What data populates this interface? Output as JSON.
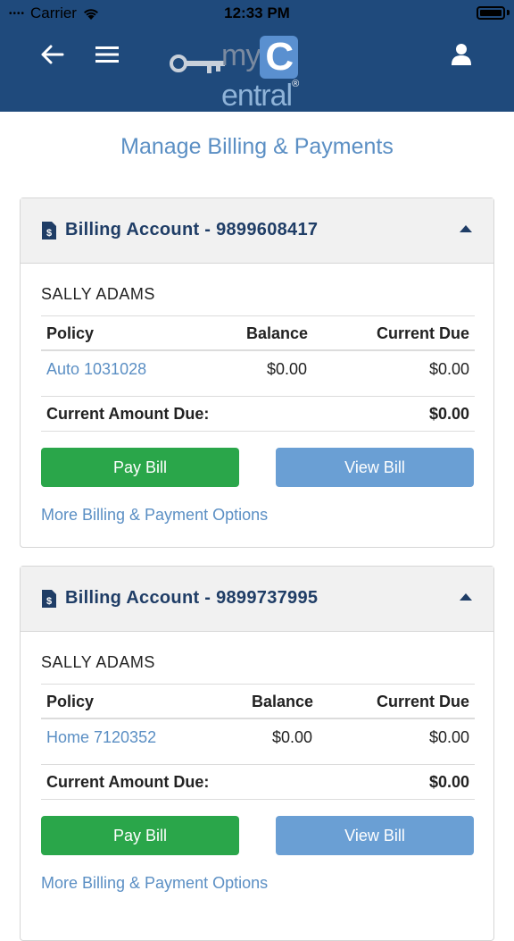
{
  "status": {
    "carrier": "Carrier",
    "time": "12:33 PM"
  },
  "header": {
    "logo": {
      "my": "my",
      "c": "C",
      "entral": "entral",
      "reg": "®"
    }
  },
  "page_title": "Manage Billing & Payments",
  "accounts": [
    {
      "title": "Billing Account - 9899608417",
      "owner": "SALLY ADAMS",
      "columns": [
        "Policy",
        "Balance",
        "Current Due"
      ],
      "policy": {
        "name": "Auto 1031028",
        "balance": "$0.00",
        "current_due": "$0.00"
      },
      "summary_label": "Current Amount Due:",
      "summary_value": "$0.00",
      "pay_label": "Pay Bill",
      "view_label": "View Bill",
      "more_label": "More Billing & Payment Options"
    },
    {
      "title": "Billing Account - 9899737995",
      "owner": "SALLY ADAMS",
      "columns": [
        "Policy",
        "Balance",
        "Current Due"
      ],
      "policy": {
        "name": "Home 7120352",
        "balance": "$0.00",
        "current_due": "$0.00"
      },
      "summary_label": "Current Amount Due:",
      "summary_value": "$0.00",
      "pay_label": "Pay Bill",
      "view_label": "View Bill",
      "more_label": "More Billing & Payment Options"
    }
  ],
  "colors": {
    "header": "#1f4a7c",
    "accent": "#5b8fc4",
    "pay": "#2aa64a",
    "view": "#6a9fd4"
  }
}
